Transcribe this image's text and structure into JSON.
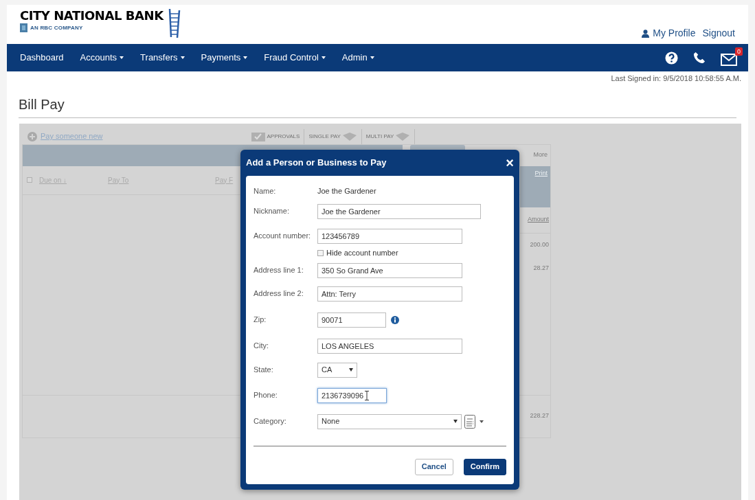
{
  "brand": {
    "name": "CITY NATIONAL BANK",
    "tagline": "AN RBC COMPANY"
  },
  "user_links": [
    "My Profile",
    "Signout"
  ],
  "nav": [
    {
      "label": "Dashboard",
      "dropdown": false
    },
    {
      "label": "Accounts",
      "dropdown": true
    },
    {
      "label": "Transfers",
      "dropdown": true
    },
    {
      "label": "Payments",
      "dropdown": true
    },
    {
      "label": "Fraud Control",
      "dropdown": true
    },
    {
      "label": "Admin",
      "dropdown": true
    }
  ],
  "mail_badge": "0",
  "last_signed_in": "Last Signed in: 9/5/2018 10:58:55 A.M.",
  "page_title": "Bill Pay",
  "background": {
    "add_link": "Pay someone new",
    "toolbar": [
      "APPROVALS",
      "SINGLE PAY",
      "MULTI PAY"
    ],
    "select_all_checked": false,
    "columns": [
      "Due on ↓",
      "Pay To",
      "Pay F"
    ],
    "more": "More",
    "print": "Print",
    "amount_header": "Amount",
    "amounts": [
      "200.00",
      "28.27"
    ],
    "total": "228.27"
  },
  "modal": {
    "title": "Add a Person or Business to Pay",
    "close": "×",
    "fields": [
      {
        "kind": "static",
        "label": "Name:",
        "value": "Joe the Gardener"
      },
      {
        "kind": "input",
        "label": "Nickname:",
        "value": "Joe the Gardener",
        "focused": false
      },
      {
        "kind": "input",
        "label": "Account number:",
        "value": "123456789",
        "focused": false
      },
      {
        "kind": "checkbox",
        "label": "Hide account number",
        "checked": false
      },
      {
        "kind": "input",
        "label": "Address line 1:",
        "value": "350 So Grand Ave",
        "focused": false
      },
      {
        "kind": "input",
        "label": "Address line 2:",
        "value": "Attn: Terry",
        "focused": false
      },
      {
        "kind": "input",
        "label": "Zip:",
        "value": "90071",
        "focused": false,
        "info": true
      },
      {
        "kind": "input",
        "label": "City:",
        "value": "LOS ANGELES",
        "focused": false
      },
      {
        "kind": "select",
        "label": "State:",
        "value": "CA"
      },
      {
        "kind": "input",
        "label": "Phone:",
        "value": "2136739096",
        "focused": true
      },
      {
        "kind": "select",
        "label": "Category:",
        "value": "None",
        "list_button": true
      }
    ],
    "buttons": [
      {
        "label": "Cancel",
        "primary": false
      },
      {
        "label": "Confirm",
        "primary": true
      }
    ]
  }
}
